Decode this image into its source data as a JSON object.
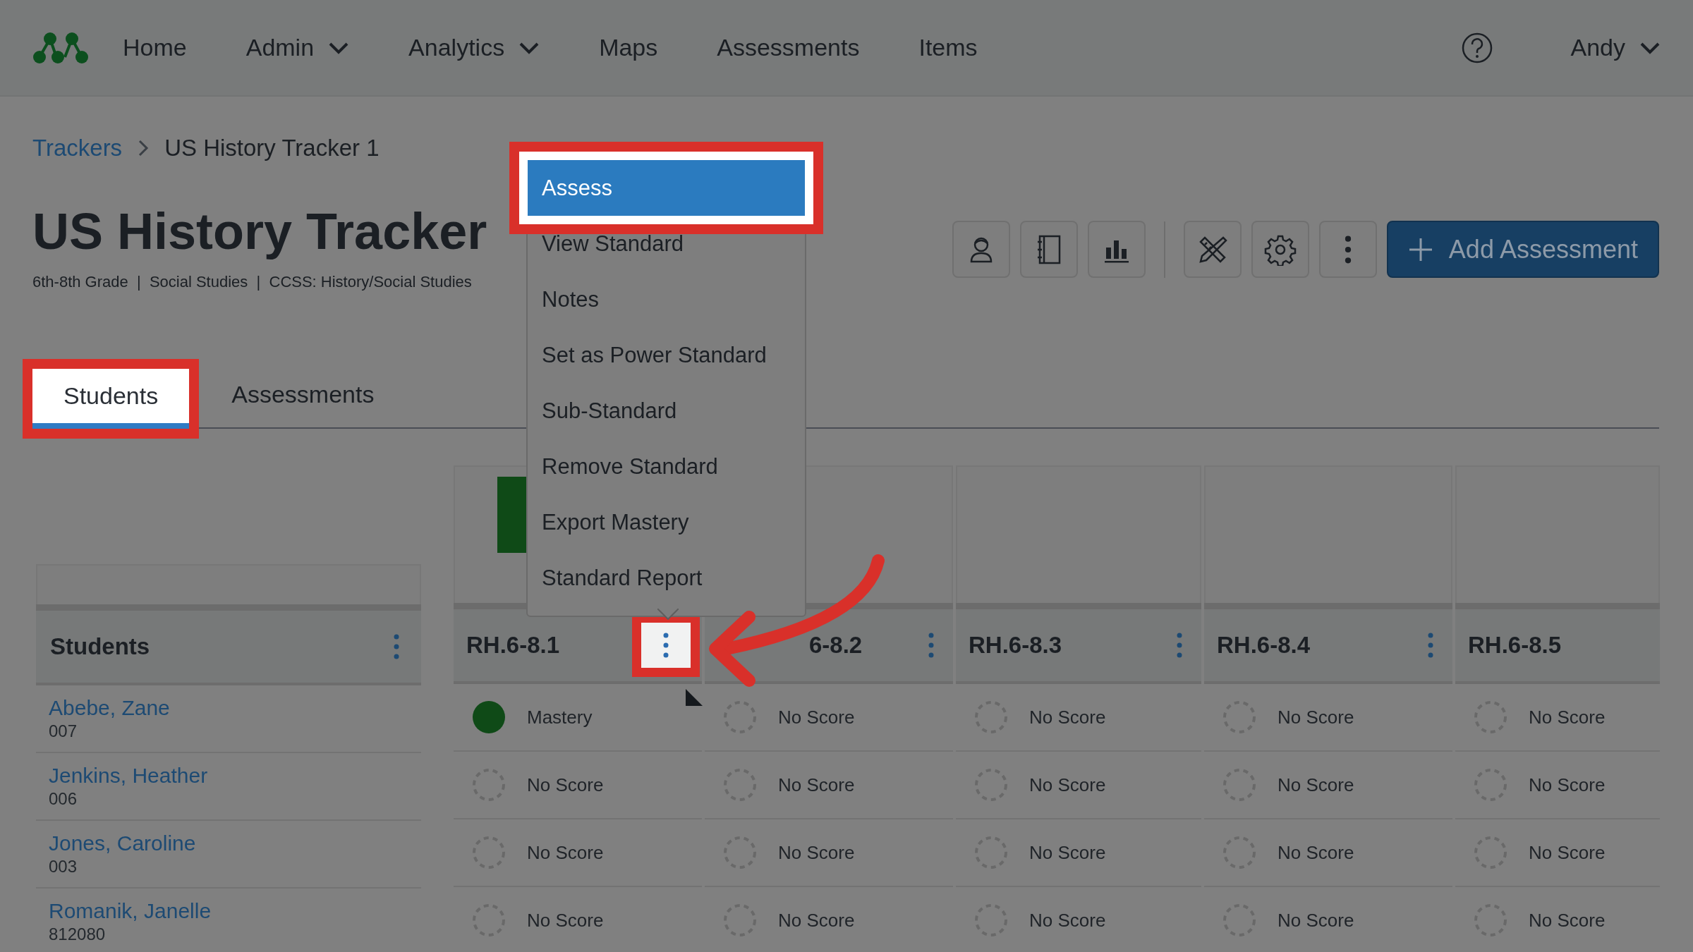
{
  "nav": {
    "items": [
      {
        "label": "Home",
        "dropdown": false
      },
      {
        "label": "Admin",
        "dropdown": true
      },
      {
        "label": "Analytics",
        "dropdown": true
      },
      {
        "label": "Maps",
        "dropdown": false
      },
      {
        "label": "Assessments",
        "dropdown": false
      },
      {
        "label": "Items",
        "dropdown": false
      }
    ],
    "user": {
      "label": "Andy",
      "dropdown": true
    }
  },
  "breadcrumb": [
    {
      "label": "Trackers",
      "kind": "link"
    },
    {
      "label": "US History Tracker 1",
      "kind": "current"
    }
  ],
  "title": "US History Tracker",
  "subtitle": "6th-8th Grade  |  Social Studies  |  CCSS: History/Social Studies",
  "toolbar": [
    {
      "kind": "person"
    },
    {
      "kind": "notebook"
    },
    {
      "kind": "chart"
    },
    {
      "kind": "divider"
    },
    {
      "kind": "tools"
    },
    {
      "kind": "settings"
    },
    {
      "kind": "more"
    }
  ],
  "primary_button": {
    "label": "Add Assessment"
  },
  "tabs": [
    {
      "label": "Students",
      "selected": true,
      "highlighted": true
    },
    {
      "label": "Assessments",
      "selected": false,
      "highlighted": false
    }
  ],
  "table": {
    "student_header": "Students",
    "standards": [
      {
        "label": "RH.6-8.1",
        "summary_bar": true,
        "menu_highlighted": true,
        "menu": true
      },
      {
        "label": "6-8.2",
        "summary_bar": false,
        "menu_highlighted": false,
        "menu": true,
        "covered": true
      },
      {
        "label": "RH.6-8.3",
        "summary_bar": false,
        "menu_highlighted": false,
        "menu": true
      },
      {
        "label": "RH.6-8.4",
        "summary_bar": false,
        "menu_highlighted": false,
        "menu": true
      },
      {
        "label": "RH.6-8.5",
        "summary_bar": false,
        "menu": false
      }
    ],
    "rows": [
      {
        "name": "Abebe, Zane",
        "id": "007",
        "scores": [
          {
            "label": "Mastery",
            "kind": "mastery"
          },
          {
            "label": "No Score",
            "kind": "none"
          },
          {
            "label": "No Score",
            "kind": "none"
          },
          {
            "label": "No Score",
            "kind": "none"
          },
          {
            "label": "No Score",
            "kind": "none"
          }
        ]
      },
      {
        "name": "Jenkins, Heather",
        "id": "006",
        "scores": [
          {
            "label": "No Score",
            "kind": "none"
          },
          {
            "label": "No Score",
            "kind": "none"
          },
          {
            "label": "No Score",
            "kind": "none"
          },
          {
            "label": "No Score",
            "kind": "none"
          },
          {
            "label": "No Score",
            "kind": "none"
          }
        ]
      },
      {
        "name": "Jones, Caroline",
        "id": "003",
        "scores": [
          {
            "label": "No Score",
            "kind": "none"
          },
          {
            "label": "No Score",
            "kind": "none"
          },
          {
            "label": "No Score",
            "kind": "none"
          },
          {
            "label": "No Score",
            "kind": "none"
          },
          {
            "label": "No Score",
            "kind": "none"
          }
        ]
      },
      {
        "name": "Romanik, Janelle",
        "id": "812080",
        "scores": [
          {
            "label": "No Score",
            "kind": "none"
          },
          {
            "label": "No Score",
            "kind": "none"
          },
          {
            "label": "No Score",
            "kind": "none"
          },
          {
            "label": "No Score",
            "kind": "none"
          },
          {
            "label": "No Score",
            "kind": "none"
          }
        ]
      }
    ]
  },
  "context_menu": {
    "items": [
      {
        "label": "Assess",
        "selected": true,
        "highlighted": true
      },
      {
        "label": "View Standard",
        "selected": false,
        "highlighted": false
      },
      {
        "label": "Notes",
        "selected": false,
        "highlighted": false
      },
      {
        "label": "Set as Power Standard",
        "selected": false,
        "highlighted": false
      },
      {
        "label": "Sub-Standard",
        "selected": false,
        "highlighted": false
      },
      {
        "label": "Remove Standard",
        "selected": false,
        "highlighted": false
      },
      {
        "label": "Export Mastery",
        "selected": false,
        "highlighted": false
      },
      {
        "label": "Standard Report",
        "selected": false,
        "highlighted": false
      }
    ]
  }
}
